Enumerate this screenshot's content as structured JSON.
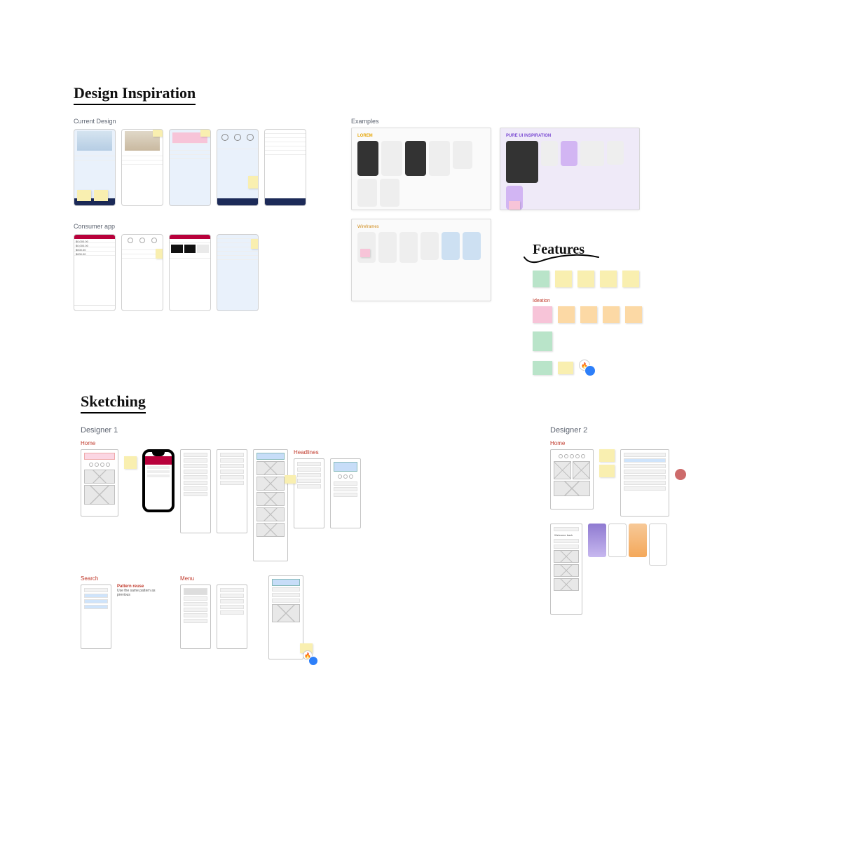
{
  "sections": {
    "design_inspiration": {
      "title": "Design Inspiration"
    },
    "features": {
      "title": "Features"
    },
    "sketching": {
      "title": "Sketching"
    }
  },
  "di": {
    "current_design_label": "Current Design",
    "consumer_app_label": "Consumer app",
    "examples_label": "Examples",
    "lorem": "LOREM",
    "pure_ui": "PURE UI INSPIRATION",
    "wireframes_label": "Wireframes"
  },
  "sketch": {
    "designer1": "Designer 1",
    "designer2": "Designer 2",
    "home": "Home",
    "search": "Search",
    "menu": "Menu",
    "headlines": "Headlines",
    "pattern_note_title": "Pattern reuse",
    "pattern_note_body": "Use the same pattern as previous"
  },
  "features_notes": {
    "ideation": "Ideation"
  }
}
